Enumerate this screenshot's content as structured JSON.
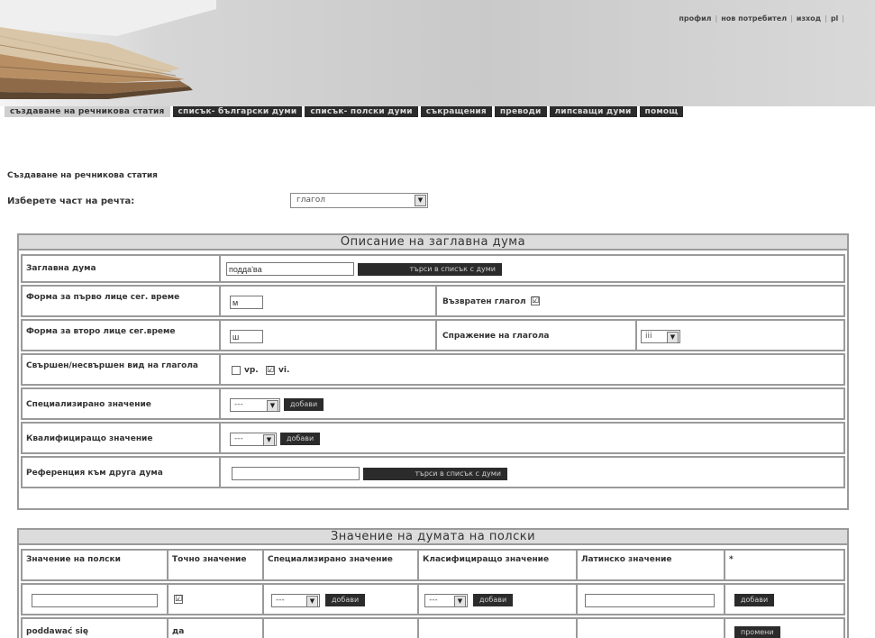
{
  "header": {
    "top_links": [
      "профил",
      "нов потребител",
      "изход",
      "pl"
    ]
  },
  "nav": {
    "tabs": [
      "създаване на речникова статия",
      "списък- български думи",
      "списък- полски думи",
      "съкращения",
      "преводи",
      "липсващи думи",
      "помощ"
    ]
  },
  "page": {
    "title": "Създаване на речникова статия",
    "pos_label": "Изберете част на речта:",
    "pos_value": "глагол"
  },
  "headword_panel": {
    "title": "Описание на заглавна дума",
    "headword_label": "Заглавна дума",
    "headword_value": "подда'ва",
    "search_button": "търси в списък с думи",
    "first_person_label": "Форма за първо лице сег. време",
    "first_person_value": "м",
    "reflexive_label": "Възвратен глагол",
    "reflexive_checked": "☑",
    "second_person_label": "Форма за второ лице сег.време",
    "second_person_value": "ш",
    "conjugation_label": "Спражение на глагола",
    "conjugation_value": "iii",
    "aspect_label": "Свършен/несвършен вид на глагола",
    "aspect_vp": "vp.",
    "aspect_vi": "vi.",
    "specialized_label": "Специализирано значение",
    "specialized_value": "---",
    "add_button": "добави",
    "qualifying_label": "Квалифициращо значение",
    "qualifying_value": "---",
    "reference_label": "Референция към друга дума",
    "reference_value": "",
    "reference_button": "търси в списък с думи"
  },
  "meaning_panel": {
    "title": "Значение на думата на полски",
    "headers": [
      "Значение на полски",
      "Точно значение",
      "Специализирано значение",
      "Класифициращо значение",
      "Латинско значение",
      "*"
    ],
    "new_row": {
      "polish_value": "",
      "exact_checked": "☑",
      "specialized_value": "---",
      "classifying_value": "---",
      "add_button": "добави",
      "latin_value": "",
      "action_button": "добави"
    },
    "existing_row": {
      "polish": "poddawać się",
      "exact": "да",
      "action_button": "промени"
    }
  }
}
